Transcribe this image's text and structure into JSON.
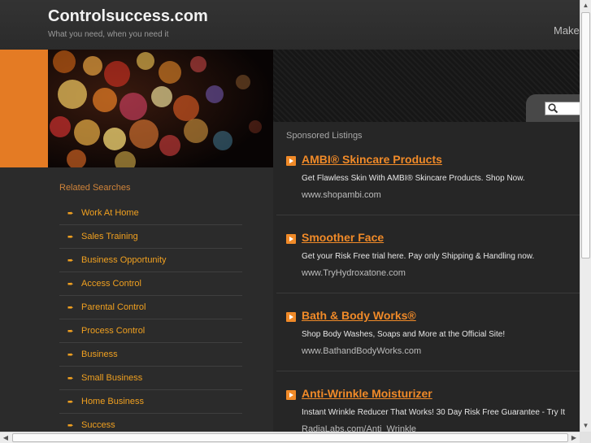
{
  "header": {
    "title": "Controlsuccess.com",
    "tagline": "What you need, when you need it",
    "make_link": "Make"
  },
  "colors": {
    "accent": "#f08a28",
    "orange_strip": "#e47b24",
    "background": "#2b2b2b",
    "link": "#f0a020"
  },
  "search": {
    "placeholder": ""
  },
  "related": {
    "title": "Related Searches",
    "items": [
      "Work At Home",
      "Sales Training",
      "Business Opportunity",
      "Access Control",
      "Parental Control",
      "Process Control",
      "Business",
      "Small Business",
      "Home Business",
      "Success"
    ]
  },
  "sponsored": {
    "title": "Sponsored Listings",
    "listings": [
      {
        "title": "AMBI® Skincare Products",
        "desc": "Get Flawless Skin With AMBI® Skincare Products. Shop Now.",
        "url": "www.shopambi.com"
      },
      {
        "title": "Smoother Face",
        "desc": "Get your Risk Free trial here. Pay only Shipping & Handling now.",
        "url": "www.TryHydroxatone.com"
      },
      {
        "title": "Bath & Body Works®",
        "desc": "Shop Body Washes, Soaps and More at the Official Site!",
        "url": "www.BathandBodyWorks.com"
      },
      {
        "title": "Anti-Wrinkle Moisturizer",
        "desc": "Instant Wrinkle Reducer That Works! 30 Day Risk Free Guarantee - Try It",
        "url": "RadiaLabs.com/Anti_Wrinkle"
      }
    ]
  },
  "icons": {
    "search": "search-icon",
    "bullet": "arrow-bullet-icon",
    "related_arrow": "pointing-hand-icon"
  }
}
